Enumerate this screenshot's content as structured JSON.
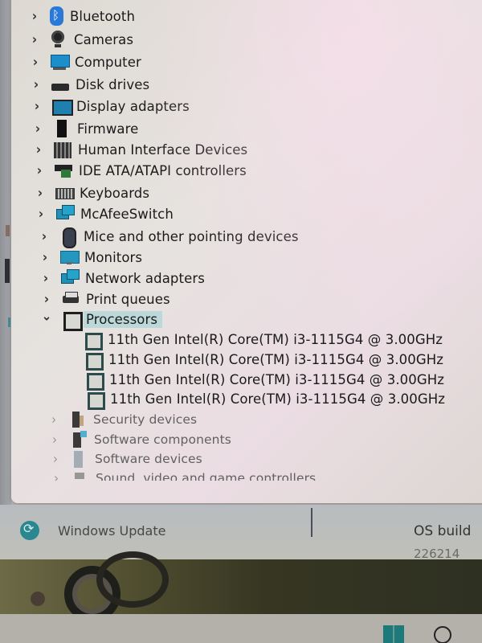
{
  "device_manager": {
    "categories": [
      {
        "label": "Bluetooth",
        "icon": "bluetooth-icon",
        "expanded": false
      },
      {
        "label": "Cameras",
        "icon": "camera-icon",
        "expanded": false
      },
      {
        "label": "Computer",
        "icon": "computer-icon",
        "expanded": false
      },
      {
        "label": "Disk drives",
        "icon": "disk-drive-icon",
        "expanded": false
      },
      {
        "label": "Display adapters",
        "icon": "display-adapter-icon",
        "expanded": false
      },
      {
        "label": "Firmware",
        "icon": "firmware-chip-icon",
        "expanded": false
      },
      {
        "label": "Human Interface Devices",
        "icon": "hid-icon",
        "expanded": false
      },
      {
        "label": "IDE ATA/ATAPI controllers",
        "icon": "ide-controller-icon",
        "expanded": false
      },
      {
        "label": "Keyboards",
        "icon": "keyboard-icon",
        "expanded": false
      },
      {
        "label": "McAfeeSwitch",
        "icon": "network-switch-icon",
        "expanded": false
      },
      {
        "label": "Mice and other pointing devices",
        "icon": "mouse-icon",
        "expanded": false
      },
      {
        "label": "Monitors",
        "icon": "monitor-icon",
        "expanded": false
      },
      {
        "label": "Network adapters",
        "icon": "network-adapter-icon",
        "expanded": false
      },
      {
        "label": "Print queues",
        "icon": "printer-icon",
        "expanded": false
      },
      {
        "label": "Processors",
        "icon": "processor-icon",
        "expanded": true,
        "selected": true
      },
      {
        "label": "Security devices",
        "icon": "security-device-icon",
        "expanded": false
      },
      {
        "label": "Software components",
        "icon": "software-component-icon",
        "expanded": false
      },
      {
        "label": "Software devices",
        "icon": "software-device-icon",
        "expanded": false
      },
      {
        "label": "Sound, video and game controllers",
        "icon": "sound-controller-icon",
        "expanded": false
      }
    ],
    "processors": [
      "11th Gen Intel(R) Core(TM) i3-1115G4 @ 3.00GHz",
      "11th Gen Intel(R) Core(TM) i3-1115G4 @ 3.00GHz",
      "11th Gen Intel(R) Core(TM) i3-1115G4 @ 3.00GHz",
      "11th Gen Intel(R) Core(TM) i3-1115G4 @ 3.00GHz"
    ],
    "chevron_collapsed": "›",
    "chevron_expanded": "⌄"
  },
  "settings": {
    "windows_update_label": "Windows Update",
    "os_build_label": "OS build",
    "os_build_value": "226214"
  },
  "colors": {
    "selection_highlight": "#bcd8d8",
    "windows_update_accent": "#2a8790"
  }
}
